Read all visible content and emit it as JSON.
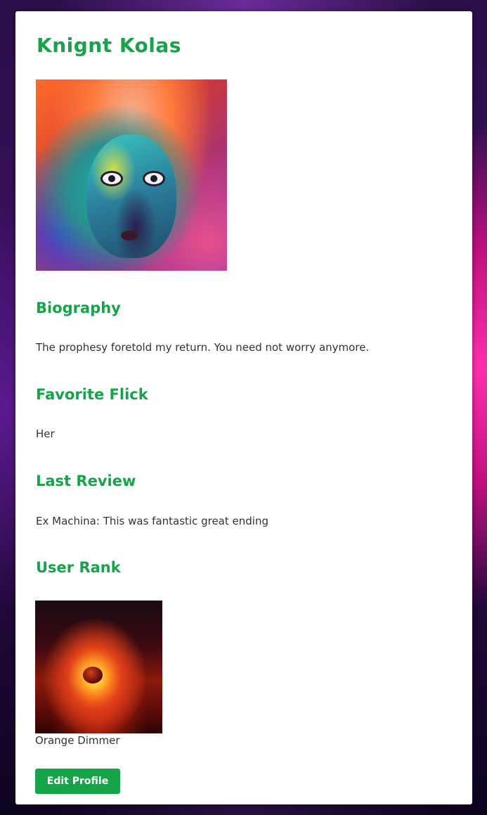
{
  "profile": {
    "name": "Knignt Kolas",
    "avatar_alt": "profile picture"
  },
  "sections": {
    "biography": {
      "heading": "Biography",
      "text": "The prophesy foretold my return. You need not worry anymore."
    },
    "favorite_flick": {
      "heading": "Favorite Flick",
      "text": "Her"
    },
    "last_review": {
      "heading": "Last Review",
      "text": "Ex Machina: This was fantastic great ending"
    },
    "user_rank": {
      "heading": "User Rank",
      "rank_name": "Orange Dimmer"
    }
  },
  "actions": {
    "edit_profile_label": "Edit Profile"
  },
  "colors": {
    "accent": "#16a34a",
    "card_background": "#ffffff",
    "body_text": "#333333"
  },
  "icons": {
    "avatar": "profile-avatar-image",
    "rank_badge": "rank-badge-image"
  }
}
